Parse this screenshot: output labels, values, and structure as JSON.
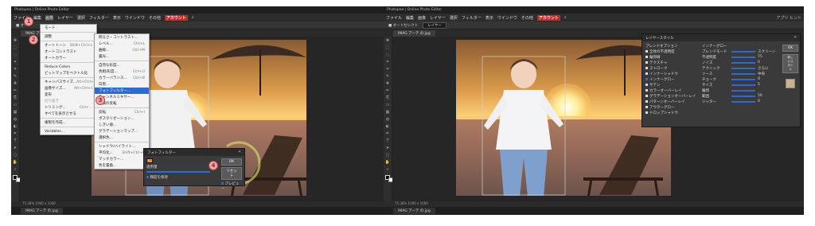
{
  "left": {
    "title": "Photopea | Online Photo Editor",
    "menu": [
      "ファイル",
      "編集",
      "画像",
      "レイヤー",
      "選択",
      "フィルター",
      "表示",
      "ウインドウ",
      "その他"
    ],
    "account": "アカウント",
    "doc_tab": "IMAG アーテ の.jpg",
    "status": "75.38% 1000 x 1000",
    "bottom_tab": "IMAG アーテ の.jpg",
    "mode_menu": [
      {
        "label": "モード",
        "sc": ""
      },
      {
        "sep": true
      },
      {
        "label": "調整",
        "sc": ""
      },
      {
        "sep": true
      },
      {
        "label": "オートトーン",
        "sc": "Shift+Ctrl+L"
      },
      {
        "label": "オートコントラスト",
        "sc": ""
      },
      {
        "label": "オートカラー",
        "sc": ""
      },
      {
        "sep": true
      },
      {
        "label": "Reduce Colors",
        "sc": ""
      },
      {
        "label": "ビットマップをベクトル化",
        "sc": ""
      },
      {
        "sep": true
      },
      {
        "label": "キャンバスサイズ...",
        "sc": "Alt+Ctrl+C"
      },
      {
        "label": "画像サイズ...",
        "sc": "Alt+Ctrl+I"
      },
      {
        "label": "変形",
        "sc": ""
      },
      {
        "label": "切り抜き",
        "sc": "",
        "dim": true
      },
      {
        "label": "トリミング...",
        "sc": "Ctrl+..."
      },
      {
        "label": "すべてを表示させる",
        "sc": ""
      },
      {
        "sep": true
      },
      {
        "label": "複製を作成...",
        "sc": ""
      },
      {
        "sep": true
      },
      {
        "label": "Variables...",
        "sc": ""
      }
    ],
    "adjust_menu": [
      {
        "label": "明るさ・コントラスト...",
        "sc": ""
      },
      {
        "label": "レベル...",
        "sc": "Ctrl+L"
      },
      {
        "label": "曲線...",
        "sc": "Ctrl+M"
      },
      {
        "label": "露光...",
        "sc": ""
      },
      {
        "sep": true
      },
      {
        "label": "自然な彩度...",
        "sc": ""
      },
      {
        "label": "色相/彩度...",
        "sc": "Ctrl+U"
      },
      {
        "label": "カラーバランス...",
        "sc": "Ctrl+B"
      },
      {
        "label": "白黒...",
        "sc": ""
      },
      {
        "label": "フォトフィルター...",
        "sc": "",
        "hl": true
      },
      {
        "label": "チャンネルミキサー...",
        "sc": ""
      },
      {
        "label": "階調の反転",
        "sc": ""
      },
      {
        "sep": true
      },
      {
        "label": "反転",
        "sc": "Ctrl+I"
      },
      {
        "label": "ポスタリゼーション...",
        "sc": ""
      },
      {
        "label": "しきい値...",
        "sc": ""
      },
      {
        "label": "グラデーションマップ...",
        "sc": ""
      },
      {
        "label": "選択色...",
        "sc": ""
      },
      {
        "sep": true
      },
      {
        "label": "シャドウ/ハイライト...",
        "sc": ""
      },
      {
        "label": "平均化...",
        "sc": "Shift+Ctrl+E"
      },
      {
        "label": "マッチカラー...",
        "sc": ""
      },
      {
        "label": "色を置換...",
        "sc": ""
      }
    ],
    "photo_filter": {
      "title": "フォトフィルター",
      "density_label": "適用量",
      "density_value": "40%",
      "ok": "OK",
      "cancel": "リセット",
      "preview": "プレビュー",
      "luminosity": "輝度を保持",
      "swatch": "#e8961e"
    },
    "badges": [
      "1",
      "2",
      "3",
      "4"
    ]
  },
  "right": {
    "title": "Photopea | Online Photo Editor",
    "menu": [
      "ファイル",
      "編集",
      "画像",
      "レイヤー",
      "選択",
      "フィルター",
      "表示",
      "ウインドウ",
      "その他"
    ],
    "account": "アカウント",
    "right_menu": "アプリ  ヒント",
    "doc_tab": "IMAG アーテ の.jpg",
    "status": "75.38% 1000 x 1000",
    "bottom_tab": "IMAG アーテ の.jpg",
    "layer_style": {
      "title": "レイヤースタイル",
      "section_left": "ブレンドオプション",
      "effects": [
        {
          "label": "全体の不透明度",
          "on": false
        },
        {
          "label": "輪郭線",
          "on": false
        },
        {
          "label": "テクスチャ",
          "on": false
        },
        {
          "label": "ストローク",
          "on": false
        },
        {
          "label": "インナーシャドウ",
          "on": false
        },
        {
          "label": "インナーグロー",
          "on": true
        },
        {
          "label": "サテン",
          "on": false
        },
        {
          "label": "カラーオーバーレイ",
          "on": false
        },
        {
          "label": "グラデーションオーバーレイ",
          "on": false
        },
        {
          "label": "パターンオーバーレイ",
          "on": false
        },
        {
          "label": "アウターグロー",
          "on": false
        },
        {
          "label": "ドロップシャドウ",
          "on": false
        }
      ],
      "section_right": "インナーグロー",
      "props": [
        {
          "label": "ブレンドモード",
          "value": "スクリーン"
        },
        {
          "label": "不透明度",
          "value": "75"
        },
        {
          "label": "ノイズ",
          "value": "0"
        },
        {
          "label": "テクニック",
          "value": "さらに"
        },
        {
          "label": "ソース",
          "value": "中央"
        },
        {
          "label": "チョーク",
          "value": "0"
        },
        {
          "label": "サイズ",
          "value": "5"
        },
        {
          "label": "輪郭",
          "value": ""
        },
        {
          "label": "範囲",
          "value": "50"
        },
        {
          "label": "ジッター",
          "value": "0"
        }
      ],
      "ok": "OK",
      "new_style": "新しいスタイル"
    }
  },
  "colors": {
    "app_bg": "#2b2b2b",
    "accent": "#2e6ad6",
    "account": "#d22323",
    "badge": "#e7a8a8"
  },
  "icons": [
    "move-icon",
    "marquee-icon",
    "lasso-icon",
    "wand-icon",
    "crop-icon",
    "eyedropper-icon",
    "heal-icon",
    "brush-icon",
    "stamp-icon",
    "eraser-icon",
    "gradient-icon",
    "blur-icon",
    "dodge-icon",
    "pen-icon",
    "text-icon",
    "path-select-icon",
    "shape-icon",
    "hand-icon",
    "zoom-icon"
  ]
}
